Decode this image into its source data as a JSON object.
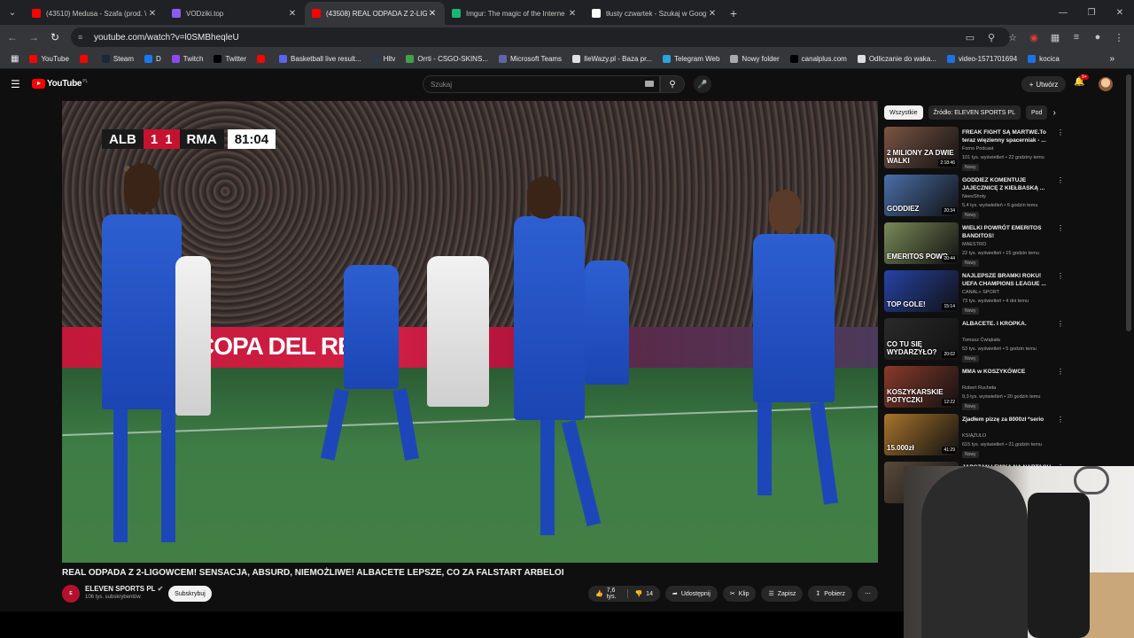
{
  "browser": {
    "tabs": [
      {
        "title": "(43510) Medusa - Szafa (prod. \\",
        "color": "#ff0000",
        "active": false
      },
      {
        "title": "VODziki.top",
        "color": "#8a5cf6",
        "active": false
      },
      {
        "title": "(43508) REAL ODPADA Z 2-LIG",
        "color": "#ff0000",
        "active": true
      },
      {
        "title": "Imgur: The magic of the Interne",
        "color": "#1bb76e",
        "active": false
      },
      {
        "title": "tłusty czwartek - Szukaj w Goog",
        "color": "#ffffff",
        "active": false
      }
    ],
    "url": "youtube.com/watch?v=l0SMBheqleU",
    "bookmarks": [
      {
        "label": "YouTube",
        "color": "#ff0000"
      },
      {
        "label": "",
        "color": "#ff0000"
      },
      {
        "label": "Steam",
        "color": "#1b2838"
      },
      {
        "label": "D",
        "color": "#1877f2"
      },
      {
        "label": "Twitch",
        "color": "#9146ff"
      },
      {
        "label": "Twitter",
        "color": "#000000"
      },
      {
        "label": "",
        "color": "#ff0000"
      },
      {
        "label": "Basketball live result...",
        "color": "#5865f2"
      },
      {
        "label": "Hltv",
        "color": "#2d3844"
      },
      {
        "label": "Orrti - CSGO-SKINS...",
        "color": "#43a047"
      },
      {
        "label": "Microsoft Teams",
        "color": "#6264a7"
      },
      {
        "label": "IleWazy.pl - Baza pr...",
        "color": "#e0e0e0"
      },
      {
        "label": "Telegram Web",
        "color": "#2aa3df"
      },
      {
        "label": "Nowy folder",
        "color": "#aaaaaa"
      },
      {
        "label": "canalplus.com",
        "color": "#000000"
      },
      {
        "label": "Odliczanie do waka...",
        "color": "#dddddd"
      },
      {
        "label": "video-1571701694",
        "color": "#1a73e8"
      },
      {
        "label": "kocica",
        "color": "#1a73e8"
      }
    ]
  },
  "youtube": {
    "logo_text": "YouTube",
    "country_code": "PL",
    "search_placeholder": "Szukaj",
    "create_label": "Utwórz",
    "notif_badge": "9+"
  },
  "video": {
    "scorebug": {
      "home": "ALB",
      "home_score": "1",
      "away_score": "1",
      "away": "RMA",
      "clock": "81:04"
    },
    "ad_text": "COPA DEL REY",
    "title": "REAL ODPADA Z 2-LIGOWCEM! SENSACJA, ABSURD, NIEMOŻLIWE! ALBACETE LEPSZE, CO ZA FALSTART ARBELOI",
    "channel": "ELEVEN SPORTS PL",
    "subscribers": "106 tys. subskrybentów",
    "subscribe_label": "Subskrybuj",
    "likes": "7,6 tys.",
    "dislikes": "14",
    "share_label": "Udostępnij",
    "clip_label": "Klip",
    "save_label": "Zapisz",
    "download_label": "Pobierz"
  },
  "chips": [
    "Wszystkie",
    "Źródło: ELEVEN SPORTS PL",
    "Pod"
  ],
  "recommendations": [
    {
      "title": "FREAK FIGHT SĄ MARTWE.To teraz więzienny spacerniak - ...",
      "channel": "Fomo Podcast",
      "meta": "101 tys. wyświetleń • 22 godziny temu",
      "duration": "2:18:46",
      "thumb_text": "2 MILIONY ZA DWIE WALKI",
      "thumb_color": "#7a5544",
      "badge": "Nowy"
    },
    {
      "title": "GODDIEZ KOMENTUJE JAJECZNICĘ Z KIEŁBASKĄ ...",
      "channel": "NeesShoty",
      "meta": "5,4 tys. wyświetleń • 6 godzin temu",
      "duration": "20:34",
      "thumb_text": "GODDIEZ",
      "thumb_color": "#4a6fa8",
      "badge": "Nowy"
    },
    {
      "title": "WIELKI POWRÓT EMERITOS BANDITOS!",
      "channel": "MAESTRO",
      "meta": "22 tys. wyświetleń • 15 godzin temu",
      "duration": "20:44",
      "thumb_text": "EMERITOS POWR",
      "thumb_color": "#7a8a58",
      "badge": "Nowy"
    },
    {
      "title": "NAJLEPSZE BRAMKI ROKU! UEFA CHAMPIONS LEAGUE ...",
      "channel": "CANAL+ SPORT",
      "meta": "73 tys. wyświetleń • 4 dni temu",
      "duration": "15:14",
      "thumb_text": "TOP GOLE!",
      "thumb_color": "#2742a6",
      "badge": "Nowy"
    },
    {
      "title": "ALBACETE. I KROPKA.",
      "channel": "Tomasz Ćwiąkała",
      "meta": "53 tys. wyświetleń • 5 godzin temu",
      "duration": "20:02",
      "thumb_text": "CO TU SIĘ WYDARZYŁO?",
      "thumb_color": "#2a2a2a",
      "badge": "Nowy"
    },
    {
      "title": "MMA w KOSZYKÓWCE",
      "channel": "Robert Rucheła",
      "meta": "9,3 tys. wyświetleń • 20 godzin temu",
      "duration": "12:22",
      "thumb_text": "KOSZYKARSKIE POTYCZKI",
      "thumb_color": "#8a3a2a",
      "badge": "Nowy"
    },
    {
      "title": "Zjadłem pizzę za 8000zł *serio",
      "channel": "KSIĄŻULO",
      "meta": "615 tys. wyświetleń • 21 godzin temu",
      "duration": "41:29",
      "thumb_text": "15.000zł",
      "thumb_color": "#a8742c",
      "badge": "Nowy"
    },
    {
      "title": "JAPCZAN I EWKA NA NARTACH",
      "channel": "",
      "meta": "",
      "duration": "",
      "thumb_text": "",
      "thumb_color": "#5a4a3a",
      "badge": ""
    }
  ]
}
